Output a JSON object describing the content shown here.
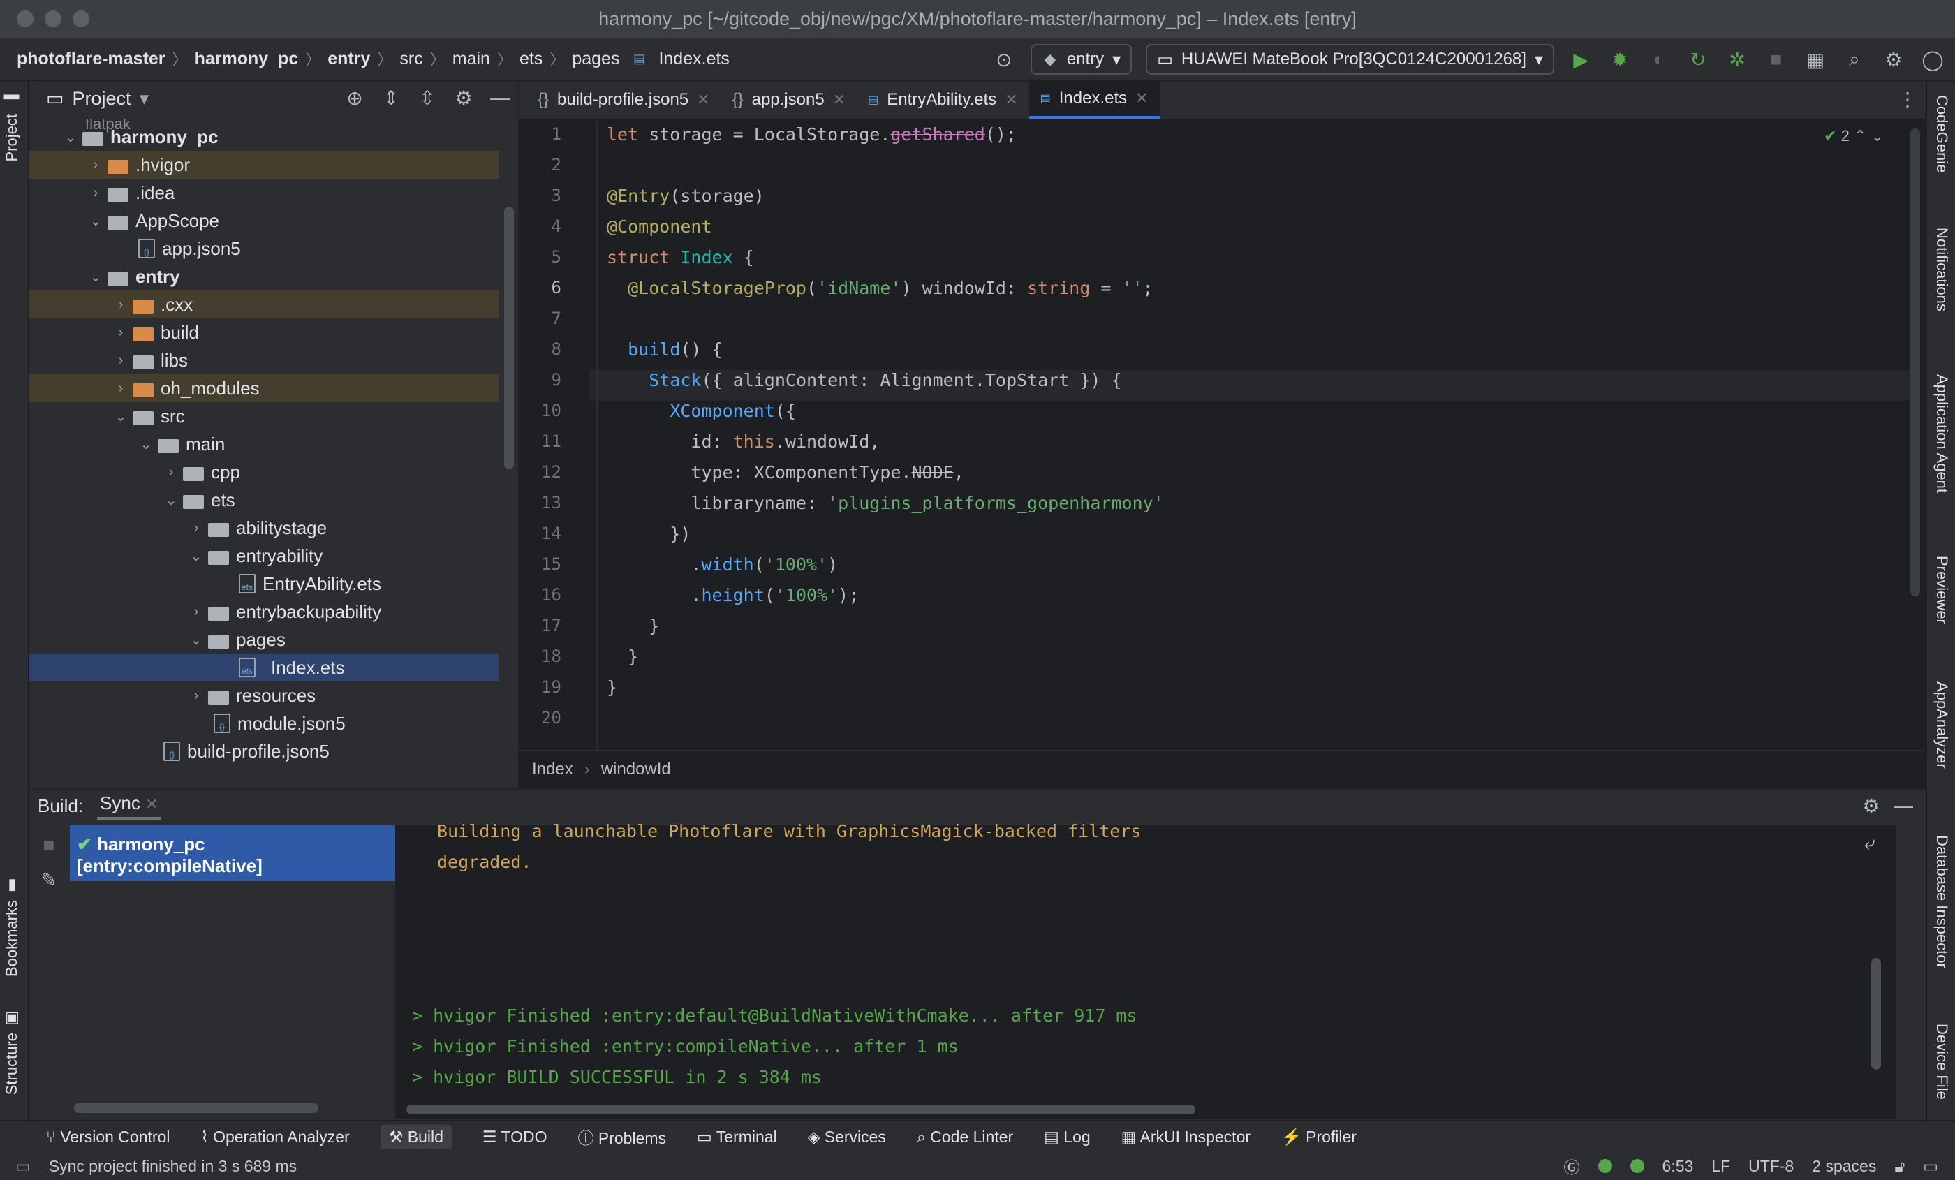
{
  "window": {
    "title": "harmony_pc [~/gitcode_obj/new/pgc/XM/photoflare-master/harmony_pc] – Index.ets [entry]"
  },
  "breadcrumbs": [
    "photoflare-master",
    "harmony_pc",
    "entry",
    "src",
    "main",
    "ets",
    "pages",
    "Index.ets"
  ],
  "run_config": {
    "module": "entry",
    "device": "HUAWEI MateBook Pro[3QC0124C20001268]"
  },
  "project": {
    "title": "Project",
    "tree": [
      {
        "label": "harmony_pc",
        "bold": true
      },
      {
        "label": ".hvigor"
      },
      {
        "label": ".idea"
      },
      {
        "label": "AppScope"
      },
      {
        "label": "app.json5"
      },
      {
        "label": "entry",
        "bold": true
      },
      {
        "label": ".cxx"
      },
      {
        "label": "build"
      },
      {
        "label": "libs"
      },
      {
        "label": "oh_modules"
      },
      {
        "label": "src"
      },
      {
        "label": "main"
      },
      {
        "label": "cpp"
      },
      {
        "label": "ets"
      },
      {
        "label": "abilitystage"
      },
      {
        "label": "entryability"
      },
      {
        "label": "EntryAbility.ets"
      },
      {
        "label": "entrybackupability"
      },
      {
        "label": "pages"
      },
      {
        "label": "Index.ets"
      },
      {
        "label": "resources"
      },
      {
        "label": "module.json5"
      },
      {
        "label": "build-profile.json5"
      }
    ]
  },
  "tabs": [
    "build-profile.json5",
    "app.json5",
    "EntryAbility.ets",
    "Index.ets"
  ],
  "editor": {
    "inspection_count": "2",
    "line_numbers": [
      "1",
      "2",
      "3",
      "4",
      "5",
      "6",
      "7",
      "8",
      "9",
      "10",
      "11",
      "12",
      "13",
      "14",
      "15",
      "16",
      "17",
      "18",
      "19",
      "20"
    ],
    "breadcrumb": [
      "Index",
      "windowId"
    ]
  },
  "build": {
    "label": "Build:",
    "tab": "Sync",
    "task": "harmony_pc [entry:compileNative]",
    "console": [
      "Building a launchable Photoflare with GraphicsMagick-backed filters",
      "degraded.",
      "> hvigor Finished :entry:default@BuildNativeWithCmake... after 917 ms",
      "> hvigor Finished :entry:compileNative... after 1 ms",
      "> hvigor BUILD SUCCESSFUL in 2 s 384 ms"
    ]
  },
  "bottom_tools": [
    "Version Control",
    "Operation Analyzer",
    "Build",
    "TODO",
    "Problems",
    "Terminal",
    "Services",
    "Code Linter",
    "Log",
    "ArkUI Inspector",
    "Profiler"
  ],
  "left_tools": [
    "Project",
    "Bookmarks",
    "Structure"
  ],
  "right_tools": [
    "CodeGenie",
    "Notifications",
    "Application Agent",
    "Previewer",
    "AppAnalyzer",
    "Database Inspector",
    "Device File"
  ],
  "status": {
    "message": "Sync project finished in 3 s 689 ms",
    "caret": "6:53",
    "line_sep": "LF",
    "encoding": "UTF-8",
    "indent": "2 spaces"
  }
}
